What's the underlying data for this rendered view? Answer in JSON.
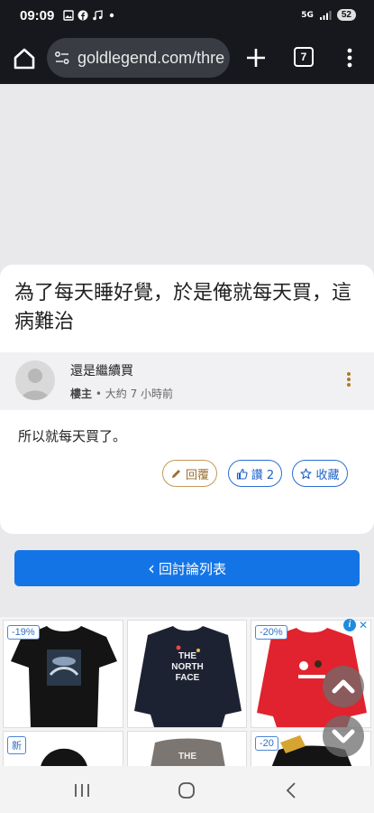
{
  "status_bar": {
    "time": "09:09",
    "network": "5G",
    "battery": "52"
  },
  "browser": {
    "url": "goldlegend.com/thre",
    "tab_count": "7"
  },
  "post": {
    "title": "為了每天睡好覺，於是俺就每天買，這病難治",
    "author": "還是繼續買",
    "role": "樓主",
    "separator": "•",
    "time_ago": "大約 7 小時前",
    "body": "所以就每天買了。",
    "reply_label": "回覆",
    "like_label": "讚 2",
    "favorite_label": "收藏"
  },
  "back_button": {
    "arrow": "‹",
    "label": "回討論列表"
  },
  "ads": {
    "badges": [
      "-19%",
      "-20%",
      "新",
      "-20"
    ]
  },
  "colors": {
    "primary_blue": "#1374e6",
    "reply_border": "#c49a58",
    "status_bar_bg": "#17181d"
  },
  "icons": [
    "home-icon",
    "site-settings-icon",
    "plus-icon",
    "tabs-icon",
    "more-vert-icon",
    "pencil-icon",
    "thumbs-up-icon",
    "star-icon",
    "chevron-up-icon",
    "chevron-down-icon",
    "recents-icon",
    "home-circle-icon",
    "back-icon"
  ]
}
